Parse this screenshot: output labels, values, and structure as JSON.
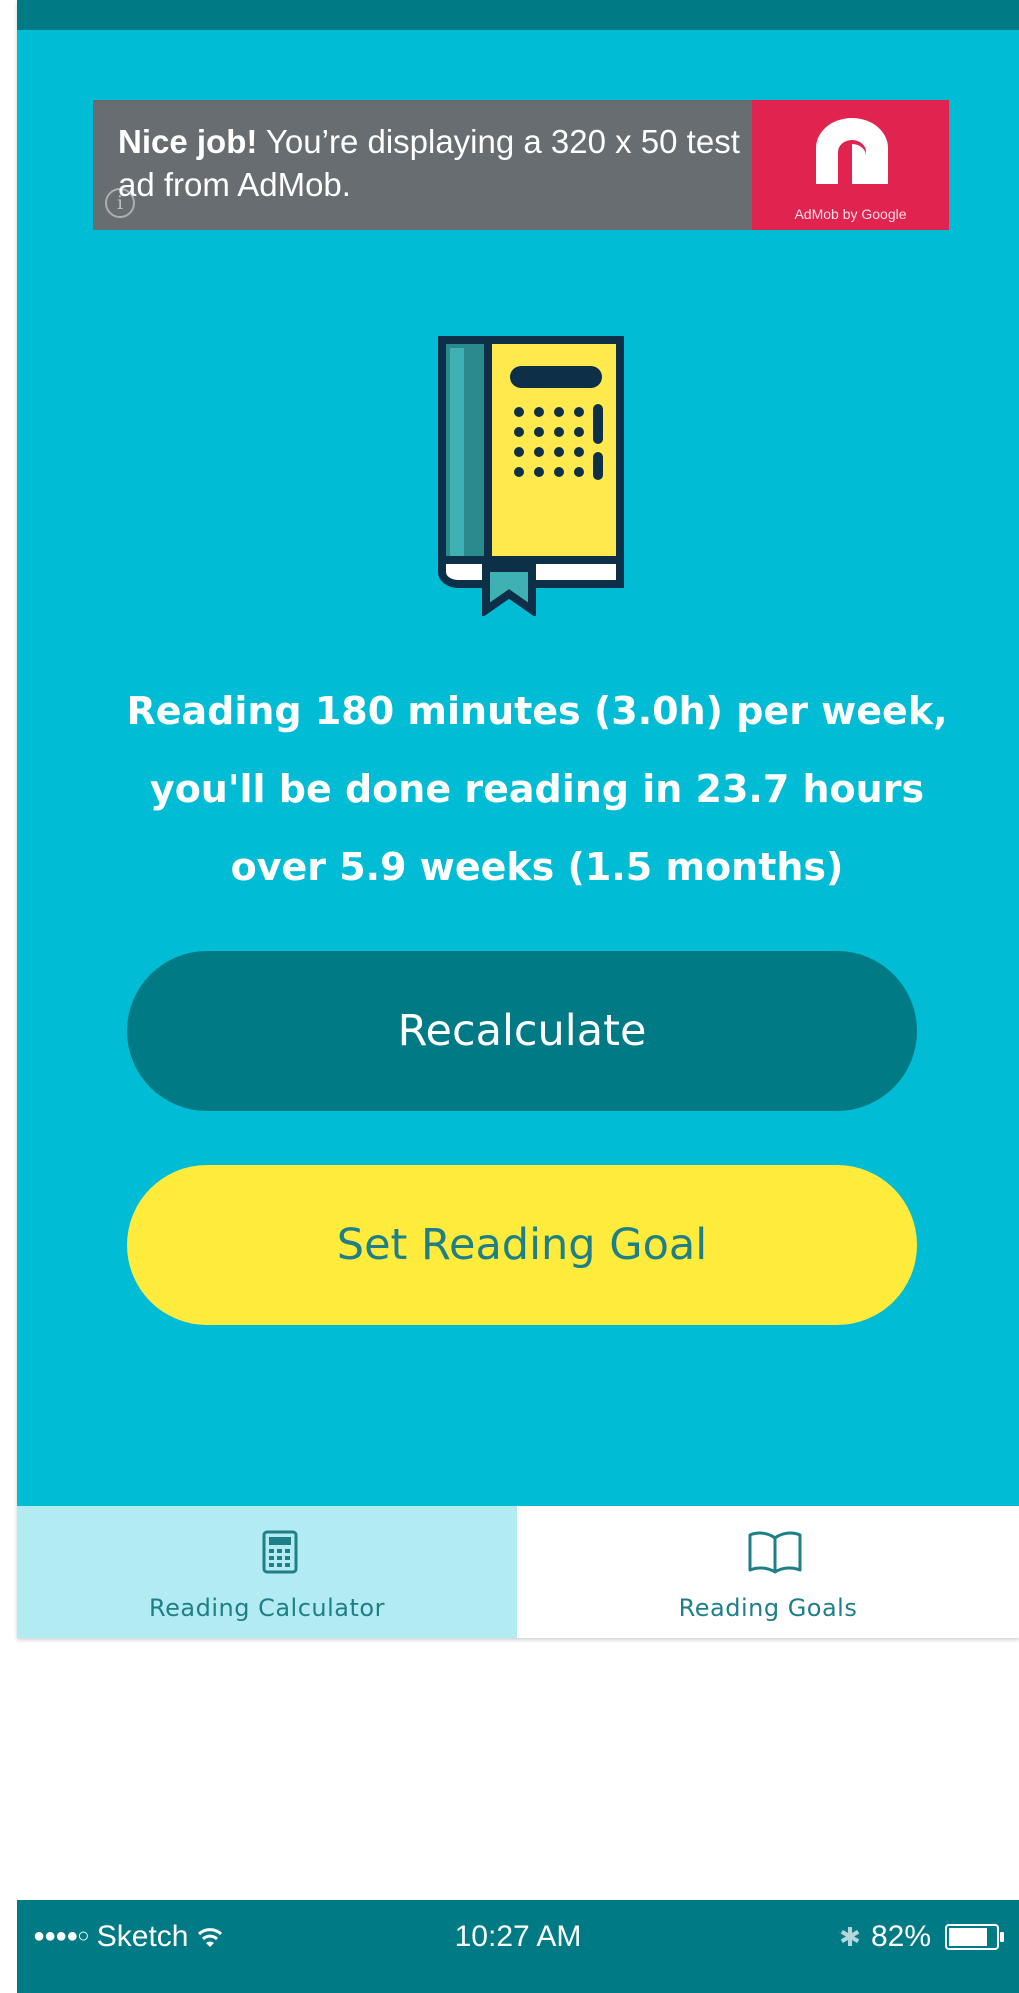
{
  "ad": {
    "bold_text": "Nice job!",
    "text": " You’re displaying a 320 x 50 test ad from AdMob.",
    "info_symbol": "i",
    "brand_text": "AdMob by Google",
    "brand_color": "#e0244f"
  },
  "result": {
    "line1": "Reading 180 minutes (3.0h) per week,",
    "line2": "you'll be done reading in 23.7 hours",
    "line3": "over 5.9 weeks (1.5 months)"
  },
  "buttons": {
    "recalculate": "Recalculate",
    "set_goal": "Set Reading Goal"
  },
  "tabs": [
    {
      "label": "Reading Calculator",
      "icon": "calculator-icon",
      "active": true
    },
    {
      "label": "Reading Goals",
      "icon": "open-book-icon",
      "active": false
    }
  ],
  "status_bar": {
    "signal": "●●●●○",
    "carrier": "Sketch",
    "time": "10:27 AM",
    "bluetooth": "✱",
    "battery": "82%"
  },
  "colors": {
    "background": "#00bcd4",
    "dark_teal": "#007b85",
    "yellow": "#ffeb3b",
    "active_tab": "#b2ebf2"
  }
}
